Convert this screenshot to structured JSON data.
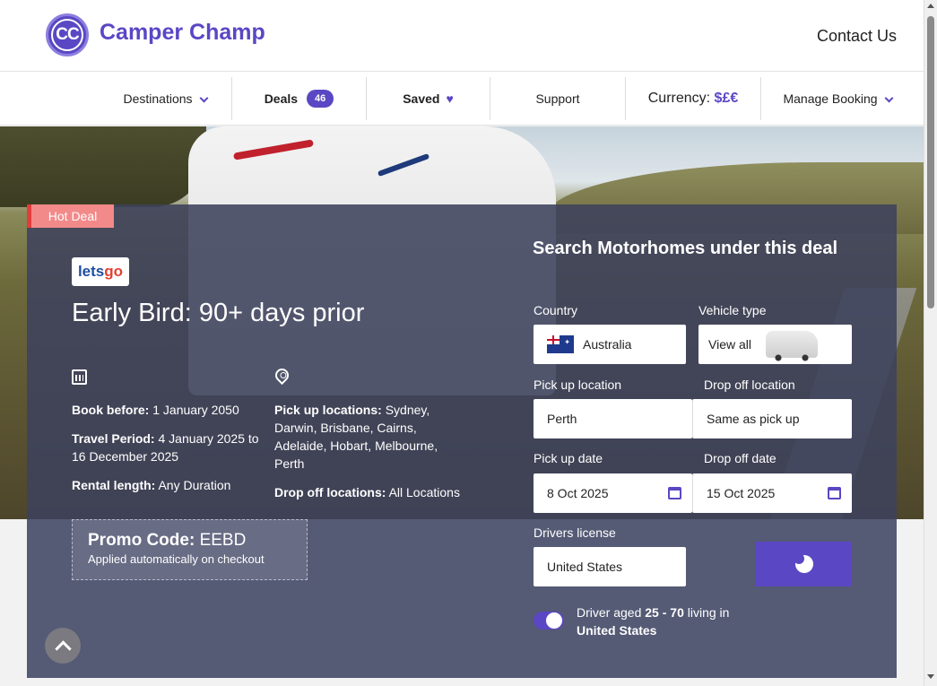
{
  "header": {
    "logo_text": "CC",
    "brand": "Camper Champ",
    "contact": "Contact Us"
  },
  "nav": {
    "destinations": "Destinations",
    "deals": "Deals",
    "deals_count": "46",
    "saved": "Saved",
    "support": "Support",
    "currency_label": "Currency:",
    "currency_value": "$£€",
    "manage_booking": "Manage Booking"
  },
  "deal": {
    "badge": "Hot Deal",
    "brand_logo_a": "lets",
    "brand_logo_b": "go",
    "title": "Early Bird: 90+ days prior",
    "book_before_label": "Book before:",
    "book_before_value": "1 January 2050",
    "travel_period_label": "Travel Period:",
    "travel_period_value": "4 January 2025 to 16 December 2025",
    "rental_length_label": "Rental length:",
    "rental_length_value": "Any Duration",
    "pickup_label": "Pick up locations:",
    "pickup_value": "Sydney, Darwin, Brisbane, Cairns, Adelaide, Hobart, Melbourne, Perth",
    "dropoff_label": "Drop off locations:",
    "dropoff_value": "All Locations",
    "promo_label": "Promo Code:",
    "promo_code": "EEBD",
    "promo_note": "Applied automatically on checkout"
  },
  "search": {
    "title": "Search Motorhomes under this deal",
    "country_label": "Country",
    "country_value": "Australia",
    "vehicle_label": "Vehicle type",
    "vehicle_value": "View all",
    "pickup_loc_label": "Pick up location",
    "pickup_loc_value": "Perth",
    "dropoff_loc_label": "Drop off location",
    "dropoff_loc_value": "Same as pick up",
    "pickup_date_label": "Pick up date",
    "pickup_date_value": "8 Oct 2025",
    "dropoff_date_label": "Drop off date",
    "dropoff_date_value": "15 Oct 2025",
    "license_label": "Drivers license",
    "license_value": "United States",
    "driver_text_a": "Driver aged",
    "driver_age": "25 - 70",
    "driver_text_b": "living in",
    "driver_country": "United States"
  },
  "colors": {
    "accent": "#5a47c4",
    "hot_deal": "#f28a8a",
    "card_overlay": "#3e425c"
  }
}
